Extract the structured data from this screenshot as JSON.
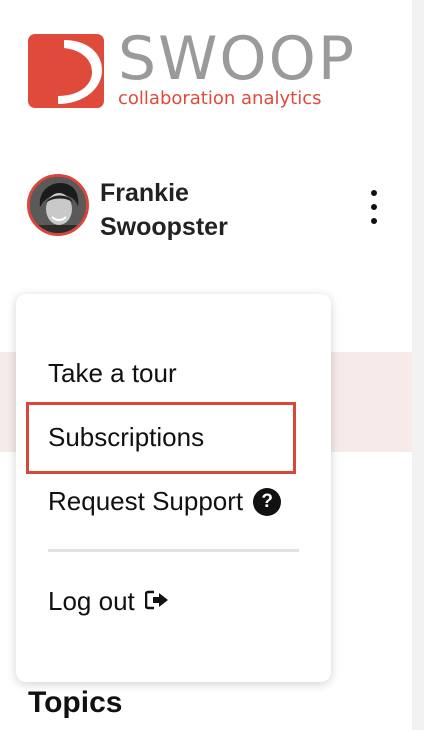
{
  "logo": {
    "word": "SWOOP",
    "tagline": "collaboration analytics",
    "brand_color": "#e04a3b"
  },
  "user": {
    "first_name": "Frankie",
    "last_name": "Swoopster"
  },
  "menu": {
    "items": [
      {
        "label": "Take a tour"
      },
      {
        "label": "Subscriptions",
        "highlighted": true
      },
      {
        "label": "Request Support",
        "icon": "question-circle-icon"
      },
      {
        "label": "Log out",
        "icon": "sign-out-icon"
      }
    ]
  },
  "section": {
    "title": "Topics"
  }
}
